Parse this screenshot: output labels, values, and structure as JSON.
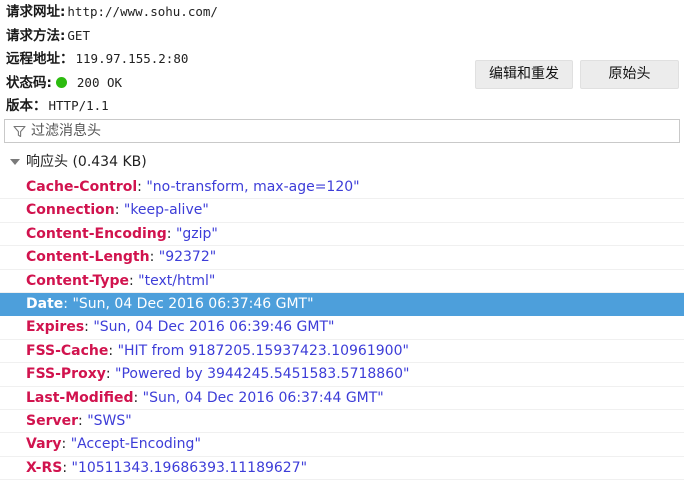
{
  "summary": {
    "url_label": "请求网址:",
    "url_value": "http://www.sohu.com/",
    "method_label": "请求方法:",
    "method_value": "GET",
    "remote_label": "远程地址：",
    "remote_value": "119.97.155.2:80",
    "status_label": "状态码:",
    "status_value": "200 OK",
    "status_color": "#2cbb0f",
    "version_label": "版本：",
    "version_value": "HTTP/1.1"
  },
  "buttons": {
    "edit_resend": "编辑和重发",
    "raw_headers": "原始头"
  },
  "filter": {
    "placeholder": "过滤消息头",
    "icon": "filter-icon"
  },
  "response_section": {
    "label": "响应头 (0.434 KB)",
    "expanded": true
  },
  "headers": [
    {
      "name": "Cache-Control",
      "value": "\"no-transform, max-age=120\"",
      "selected": false
    },
    {
      "name": "Connection",
      "value": "\"keep-alive\"",
      "selected": false
    },
    {
      "name": "Content-Encoding",
      "value": "\"gzip\"",
      "selected": false
    },
    {
      "name": "Content-Length",
      "value": "\"92372\"",
      "selected": false
    },
    {
      "name": "Content-Type",
      "value": "\"text/html\"",
      "selected": false
    },
    {
      "name": "Date",
      "value": "\"Sun, 04 Dec 2016 06:37:46 GMT\"",
      "selected": true
    },
    {
      "name": "Expires",
      "value": "\"Sun, 04 Dec 2016 06:39:46 GMT\"",
      "selected": false
    },
    {
      "name": "FSS-Cache",
      "value": "\"HIT from 9187205.15937423.10961900\"",
      "selected": false
    },
    {
      "name": "FSS-Proxy",
      "value": "\"Powered by 3944245.5451583.5718860\"",
      "selected": false
    },
    {
      "name": "Last-Modified",
      "value": "\"Sun, 04 Dec 2016 06:37:44 GMT\"",
      "selected": false
    },
    {
      "name": "Server",
      "value": "\"SWS\"",
      "selected": false
    },
    {
      "name": "Vary",
      "value": "\"Accept-Encoding\"",
      "selected": false
    },
    {
      "name": "X-RS",
      "value": "\"10511343.19686393.11189627\"",
      "selected": false
    }
  ],
  "colors": {
    "header_name": "#d1134e",
    "header_value": "#3d3dd8",
    "selection": "#4d9fdb"
  }
}
